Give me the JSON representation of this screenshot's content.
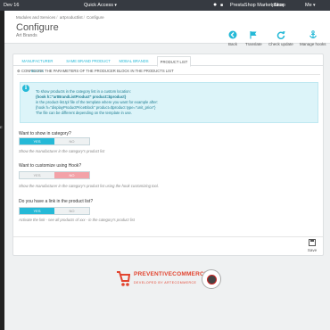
{
  "topbar": {
    "brand": "Dev 16",
    "quick_access": "Quick Access",
    "marketplace": "PrestaShop Marketplace",
    "shop": "Shop",
    "me": "Me"
  },
  "sidebar": {
    "edge_label": "E"
  },
  "header": {
    "breadcrumb": [
      "Modules and Services",
      "artproductlist",
      "Configure"
    ],
    "title": "Configure",
    "subtitle": "Art Brands"
  },
  "toolbar": {
    "back": "Back",
    "translate": "Translate",
    "check_update": "Check update",
    "manage_hooks": "Manage hooks"
  },
  "tabs": [
    "MANUFACTURER BLOCK",
    "SAME BRAND PRODUCT",
    "MOBAL BRANDS",
    "PRODUCT LIST"
  ],
  "section_title": "CONFIGURE THE PARAMETERS OF THE PRODUCER BLOCK IN THE PRODUCTS LIST",
  "info": {
    "lines": [
      "To show products in the category list in a custom location:",
      "{hook h=\"artBrandListProduct\" product=$product}",
      "in the product-list.tpl file of the template where you want for example after:",
      "{hook h=\"displayProductPriceBlock\" product=$product type=\"unit_price\"}",
      "The file can be different depending on the template in use."
    ]
  },
  "questions": [
    {
      "label": "Want to show in category?",
      "yes": "YES",
      "no": "NO",
      "selected": "yes",
      "help": "Show the manufacturer in the category's product list"
    },
    {
      "label": "Want to customize using Hook?",
      "yes": "YES",
      "no": "NO",
      "selected": "no",
      "help": "Show the manufacturer in the category's product list using the hook customizing tool."
    },
    {
      "label": "Do you have a link in the product list?",
      "yes": "YES",
      "no": "NO",
      "selected": "yes",
      "help": "Activate the link - see all products of xxx - in the category's product list"
    }
  ],
  "save_label": "Save",
  "logo": {
    "name": "PREVENTIVECOMMERCE",
    "tagline": "DEVELOPED BY ARTECOMMERCE"
  },
  "colors": {
    "accent": "#25b9d7",
    "no_on": "#f3a2a8",
    "topbar": "#363a41",
    "logo": "#e2442f"
  }
}
